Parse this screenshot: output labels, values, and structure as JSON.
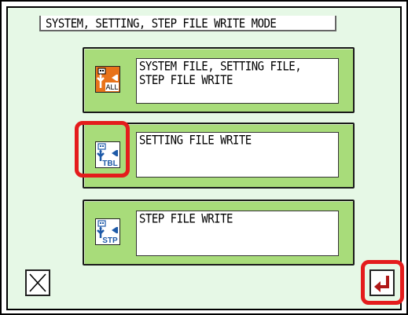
{
  "header": {
    "title": "SYSTEM, SETTING, STEP FILE WRITE MODE"
  },
  "options": [
    {
      "label": "SYSTEM FILE, SETTING FILE,\nSTEP FILE WRITE",
      "icon": "usb-all-write-icon",
      "icon_text": "ALL"
    },
    {
      "label": "SETTING FILE WRITE",
      "icon": "usb-tbl-write-icon",
      "icon_text": "TBL"
    },
    {
      "label": "STEP FILE WRITE",
      "icon": "usb-stp-write-icon",
      "icon_text": "STP"
    }
  ],
  "footer": {
    "cancel_icon": "close-icon",
    "enter_icon": "enter-return-icon"
  },
  "colors": {
    "panel_bg": "#e6f8e6",
    "button_bg": "#a8dc7a",
    "highlight": "#e41c1c",
    "enter_arrow": "#b01818",
    "icon_blue": "#1e5aa8",
    "icon_orange": "#e57b1e"
  }
}
